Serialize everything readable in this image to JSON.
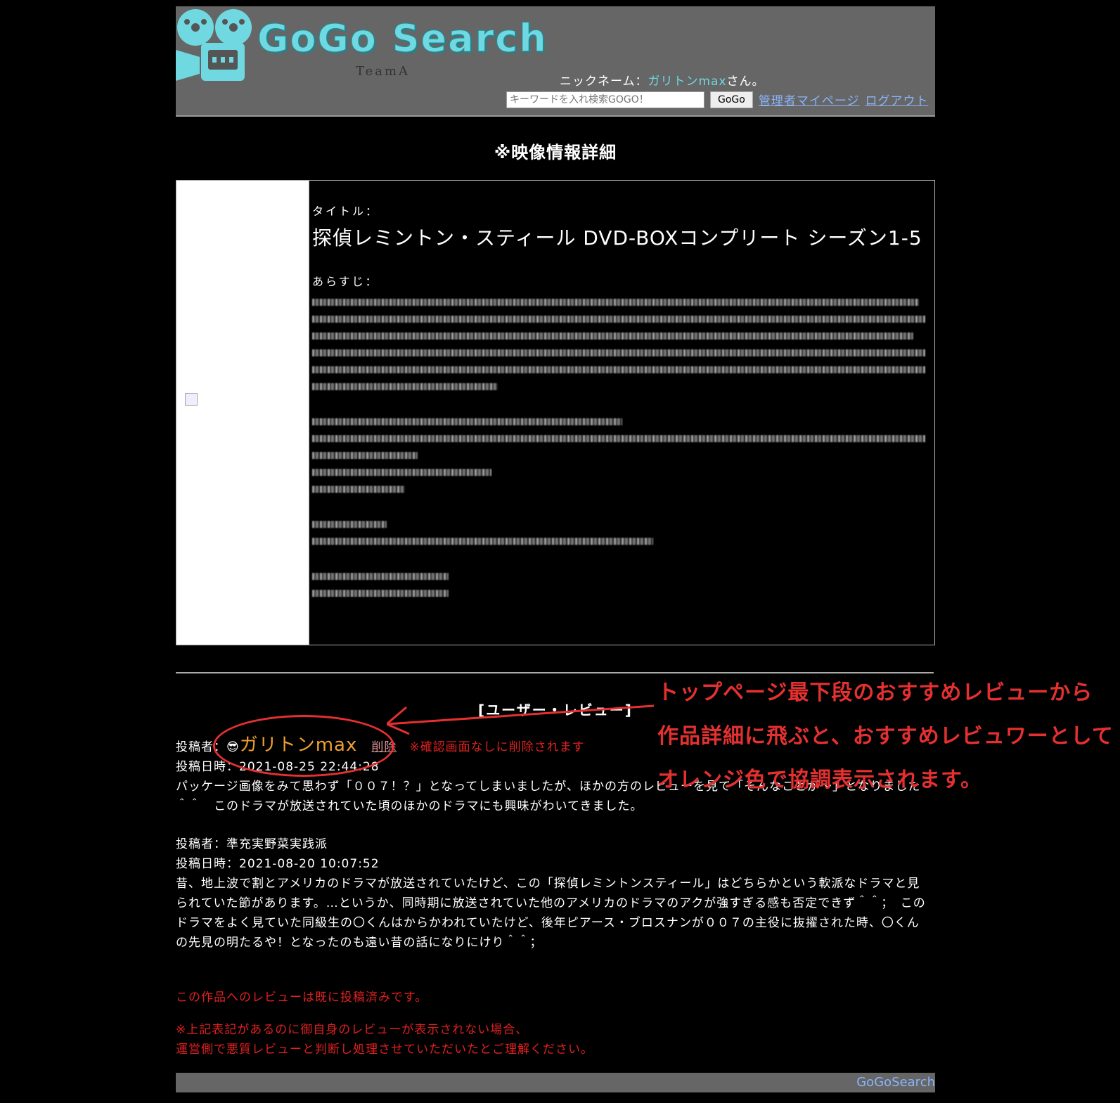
{
  "header": {
    "logo_text": "GoGo Search",
    "team": "TeamA",
    "nickname_label": "ニックネーム：",
    "nickname": "ガリトンmax",
    "nickname_suffix": "さん。",
    "search_placeholder": "キーワードを入れ検索GOGO！",
    "search_button": "GoGo",
    "link_admin": "管理者マイページ",
    "link_logout": "ログアウト"
  },
  "page_title": "※映像情報詳細",
  "detail": {
    "title_label": "タイトル：",
    "title": "探偵レミントン・スティール DVD-BOXコンプリート シーズン1-5",
    "synopsis_label": "あらすじ："
  },
  "reviews_heading": "[ユーザー・レビュー]",
  "reviews": [
    {
      "poster_label": "投稿者：",
      "poster_icon": "😎",
      "poster": "ガリトンmax",
      "delete": "削除",
      "delete_note": "※確認画面なしに削除されます",
      "date_label": "投稿日時：",
      "date": "2021-08-25 22:44:28",
      "text": "パッケージ画像をみて思わず「００７！？」となってしまいましたが、ほかの方のレビューを見て「そんなことが～」となりました＾＾　このドラマが放送されていた頃のほかのドラマにも興味がわいてきました。"
    },
    {
      "poster_label": "投稿者：",
      "poster": "準充実野菜実践派",
      "date_label": "投稿日時：",
      "date": "2021-08-20 10:07:52",
      "text": "昔、地上波で割とアメリカのドラマが放送されていたけど、この「探偵レミントンスティール」はどちらかという軟派なドラマと見られていた節があります。…というか、同時期に放送されていた他のアメリカのドラマのアクが強すぎる感も否定できず＾＾；　このドラマをよく見ていた同級生の〇くんはからかわれていたけど、後年ピアース・ブロスナンが００７の主役に抜擢された時、〇くんの先見の明たるや！となったのも遠い昔の話になりにけり＾＾；"
    }
  ],
  "notice1": "この作品へのレビューは既に投稿済みです。",
  "notice2_line1": "※上記表記があるのに御自身のレビューが表示されない場合、",
  "notice2_line2": "運営側で悪質レビューと判断し処理させていただいたとご理解ください。",
  "footer": "GoGoSearch",
  "annotation": "トップページ最下段のおすすめレビューから作品詳細に飛ぶと、おすすめレビュワーとしてオレンジ色で協調表示されます。",
  "colors": {
    "header_bg": "#666666",
    "logo": "#6fd8e0",
    "link": "#8ab4f8",
    "recommended": "#f0a030",
    "warning": "#e02020"
  }
}
